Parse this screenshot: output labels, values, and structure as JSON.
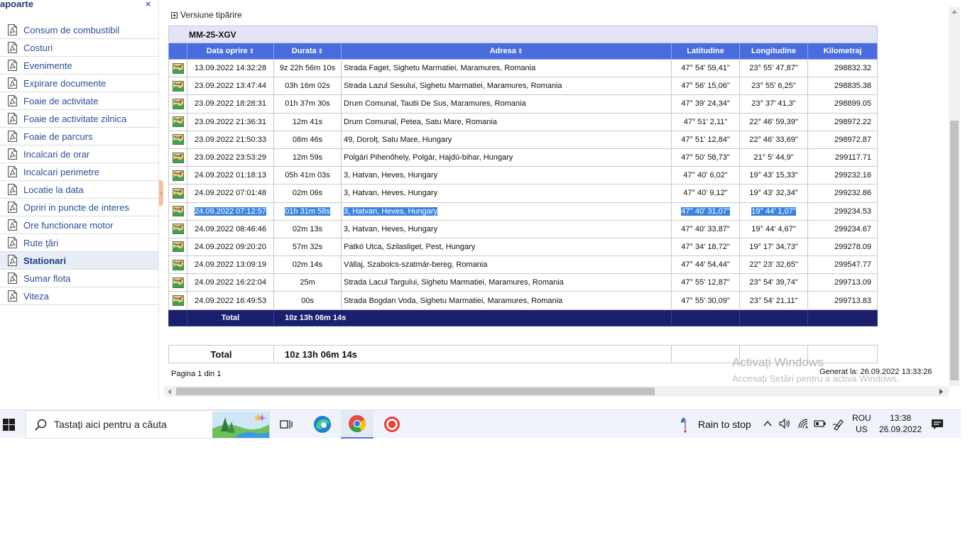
{
  "sidebar": {
    "title": "apoarte",
    "close_label": "×",
    "items": [
      {
        "label": "Consum de combustibil",
        "active": false
      },
      {
        "label": "Costuri",
        "active": false
      },
      {
        "label": "Evenimente",
        "active": false
      },
      {
        "label": "Expirare documente",
        "active": false
      },
      {
        "label": "Foaie de activitate",
        "active": false
      },
      {
        "label": "Foaie de activitate zilnica",
        "active": false
      },
      {
        "label": "Foaie de parcurs",
        "active": false
      },
      {
        "label": "Incalcari de orar",
        "active": false
      },
      {
        "label": "Incalcari perimetre",
        "active": false
      },
      {
        "label": "Locatie la data",
        "active": false
      },
      {
        "label": "Opriri in puncte de interes",
        "active": false
      },
      {
        "label": "Ore functionare motor",
        "active": false
      },
      {
        "label": "Rute ţări",
        "active": false
      },
      {
        "label": "Stationari",
        "active": true
      },
      {
        "label": "Sumar flota",
        "active": false
      },
      {
        "label": "Viteza",
        "active": false
      }
    ]
  },
  "report": {
    "print_label": "Versiune tipărire",
    "vehicle": "MM-25-XGV",
    "columns": {
      "date": "Data oprire",
      "duration": "Durata",
      "address": "Adresa",
      "lat": "Latitudine",
      "lon": "Longitudine",
      "km": "Kilometraj"
    },
    "rows": [
      {
        "date": "13.09.2022 14:32:28",
        "duration": "9z 22h 56m 10s",
        "address": "Strada Faget,   Sighetu Marmatiei, Maramures, Romania",
        "lat": "47° 54' 59,41\"",
        "lon": "23° 55' 47,87\"",
        "km": "298832.32",
        "selected": false
      },
      {
        "date": "23.09.2022 13:47:44",
        "duration": "03h 16m 02s",
        "address": "Strada Lazul Sesului,   Sighetu Marmatiei, Maramures, Romania",
        "lat": "47° 56' 15,06\"",
        "lon": "23° 55' 6,25\"",
        "km": "298835.38",
        "selected": false
      },
      {
        "date": "23.09.2022 18:28:31",
        "duration": "01h 37m 30s",
        "address": "Drum Comunal,   Tautii De Sus, Maramures, Romania",
        "lat": "47° 39' 24,34\"",
        "lon": "23° 37' 41,3\"",
        "km": "298899.05",
        "selected": false
      },
      {
        "date": "23.09.2022 21:36:31",
        "duration": "12m 41s",
        "address": "Drum Comunal,   Petea, Satu Mare, Romania",
        "lat": "47° 51' 2,11\"",
        "lon": "22° 46' 59,39\"",
        "km": "298972.22",
        "selected": false
      },
      {
        "date": "23.09.2022 21:50:33",
        "duration": "08m 46s",
        "address": "49,   Dorolț, Satu Mare, Hungary",
        "lat": "47° 51' 12,84\"",
        "lon": "22° 46' 33,69\"",
        "km": "298972.87",
        "selected": false
      },
      {
        "date": "23.09.2022 23:53:29",
        "duration": "12m 59s",
        "address": "Polgári Pihenőhely,   Polgár, Hajdú-bihar, Hungary",
        "lat": "47° 50' 58,73\"",
        "lon": "21° 5' 44,9\"",
        "km": "299117.71",
        "selected": false
      },
      {
        "date": "24.09.2022 01:18:13",
        "duration": "05h 41m 03s",
        "address": "3,   Hatvan, Heves, Hungary",
        "lat": "47° 40' 6,02\"",
        "lon": "19° 43' 15,33\"",
        "km": "299232.16",
        "selected": false
      },
      {
        "date": "24.09.2022 07:01:48",
        "duration": "02m 06s",
        "address": "3,   Hatvan, Heves, Hungary",
        "lat": "47° 40' 9,12\"",
        "lon": "19° 43' 32,34\"",
        "km": "299232.86",
        "selected": false
      },
      {
        "date": "24.09.2022 07:12:57",
        "duration": "01h 31m 58s",
        "address": "3,   Hatvan, Heves, Hungary",
        "lat": "47° 40' 31,07\"",
        "lon": "19° 44' 1,07\"",
        "km": "299234.53",
        "selected": true
      },
      {
        "date": "24.09.2022 08:46:46",
        "duration": "02m 13s",
        "address": "3,   Hatvan, Heves, Hungary",
        "lat": "47° 40' 33,87\"",
        "lon": "19° 44' 4,67\"",
        "km": "299234.67",
        "selected": false
      },
      {
        "date": "24.09.2022 09:20:20",
        "duration": "57m 32s",
        "address": "Patkó Utca,   Szilasliget, Pest, Hungary",
        "lat": "47° 34' 18,72\"",
        "lon": "19° 17' 34,73\"",
        "km": "299278.09",
        "selected": false
      },
      {
        "date": "24.09.2022 13:09:19",
        "duration": "02m 14s",
        "address": "Vállaj, Szabolcs-szatmár-bereg, Romania",
        "lat": "47° 44' 54,44\"",
        "lon": "22° 23' 32,65\"",
        "km": "299547.77",
        "selected": false
      },
      {
        "date": "24.09.2022 16:22:04",
        "duration": "25m",
        "address": "Strada Lacul Targului,   Sighetu Marmatiei, Maramures, Romania",
        "lat": "47° 55' 12,87\"",
        "lon": "23° 54' 39,74\"",
        "km": "299713.09",
        "selected": false
      },
      {
        "date": "24.09.2022 16:49:53",
        "duration": "00s",
        "address": "Strada Bogdan Voda,   Sighetu Marmatiei, Maramures, Romania",
        "lat": "47° 55' 30,09\"",
        "lon": "23° 54' 21,11\"",
        "km": "299713.83",
        "selected": false
      }
    ],
    "total_label": "Total",
    "total_duration": "10z 13h 06m 14s",
    "summary_total_label": "Total",
    "summary_total_duration": "10z 13h 06m 14s",
    "pagination": "Pagina 1 din 1",
    "generated": "Generat la: 26.09.2022 13:33:26"
  },
  "watermark": {
    "line1": "Activați Windows",
    "line2": "Accesați Setări pentru a activa Windows."
  },
  "taskbar": {
    "search_placeholder": "Tastați aici pentru a căuta",
    "weather": "Rain to stop",
    "lang_line1": "ROU",
    "lang_line2": "US",
    "time": "13:38",
    "date": "26.09.2022"
  },
  "colors": {
    "header_blue": "#4a6cdf",
    "total_navy": "#1a1f6e",
    "vehicle_row": "#e3e5f7",
    "link_blue": "#2d4e9a",
    "selection": "#3a84e0"
  }
}
